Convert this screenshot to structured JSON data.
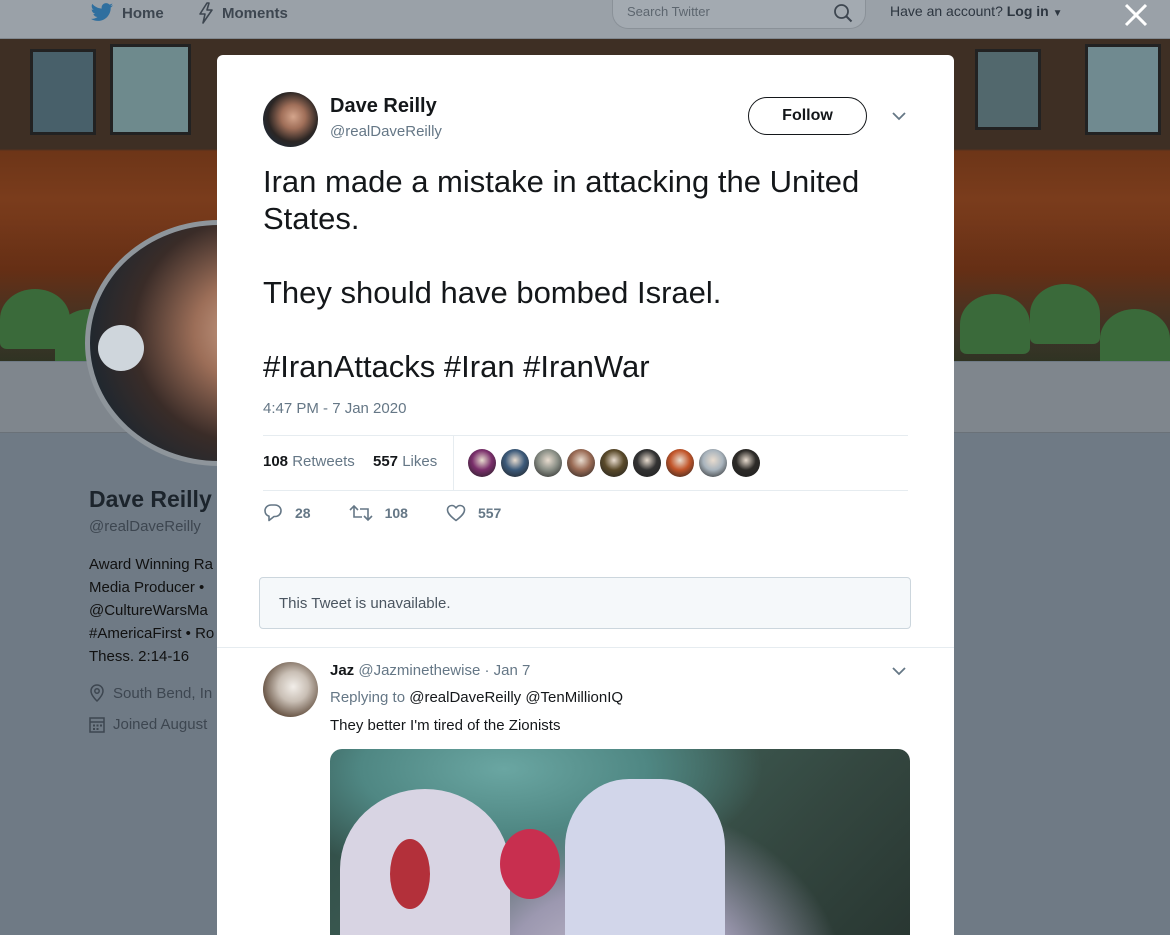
{
  "topbar": {
    "home_label": "Home",
    "moments_label": "Moments",
    "search_placeholder": "Search Twitter",
    "account_prompt": "Have an account?",
    "login_label": "Log in"
  },
  "profile": {
    "name": "Dave Reilly",
    "handle": "@realDaveReilly",
    "bio": "Award Winning Ra\nMedia Producer •\n@CultureWarsMa\n#AmericaFirst • Ro\nThess. 2:14-16",
    "location": "South Bend, In",
    "joined": "Joined August"
  },
  "tweet": {
    "author_name": "Dave Reilly",
    "author_handle": "@realDaveReilly",
    "follow_label": "Follow",
    "text_line1": "Iran made a mistake in attacking the United States.",
    "text_line2": "They should have bombed Israel.",
    "text_line3": "#IranAttacks #Iran #IranWar",
    "timestamp": "4:47 PM - 7 Jan 2020",
    "retweets_count": "108",
    "retweets_label": "Retweets",
    "likes_count": "557",
    "likes_label": "Likes",
    "reply_count": "28",
    "retweet_action_count": "108",
    "like_action_count": "557",
    "liker_colors": [
      "#7a2f6b",
      "#3c5a7a",
      "#8a8f86",
      "#9a6b55",
      "#5a4a2a",
      "#333333",
      "#c2552a",
      "#a9b4bd",
      "#2d2b28"
    ]
  },
  "unavailable_notice": "This Tweet is unavailable.",
  "reply": {
    "author_name": "Jaz",
    "author_handle": "@Jazminethewise",
    "date": "· Jan 7",
    "replying_to_label": "Replying to",
    "replying_to_users": "@realDaveReilly @TenMillionIQ",
    "text": "They better I'm tired of the Zionists"
  }
}
